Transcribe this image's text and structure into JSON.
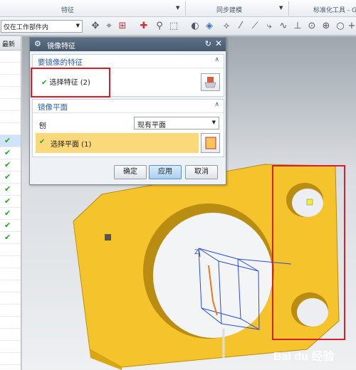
{
  "ribbon": {
    "groups": [
      "特征",
      "同步建模",
      "标准化工具 - G"
    ]
  },
  "toolbar": {
    "scope_filter": "仅在工作部件内"
  },
  "navigator": {
    "header": "最新",
    "row_checked": [
      false,
      false,
      false,
      false,
      false,
      false,
      false,
      true,
      true,
      true,
      true,
      true,
      true,
      true,
      true,
      true,
      false,
      false,
      false,
      false,
      false,
      false,
      false,
      false,
      false,
      false
    ]
  },
  "dialog": {
    "title": "镜像特征",
    "feature_section": {
      "title": "要镜像的特征",
      "selection_label": "选择特征 (2)"
    },
    "plane_section": {
      "title": "镜像平面",
      "plane_label": "刨",
      "plane_option": "现有平面",
      "selection_label": "选择平面 (1)"
    },
    "buttons": {
      "ok": "确定",
      "apply": "应用",
      "cancel": "取消"
    }
  },
  "viewport": {
    "axis_label": "Z"
  },
  "watermark": "Bai du 经验",
  "colors": {
    "part": "#f5c32b",
    "highlight": "#d4202a",
    "selected_row": "#fbd97a"
  }
}
